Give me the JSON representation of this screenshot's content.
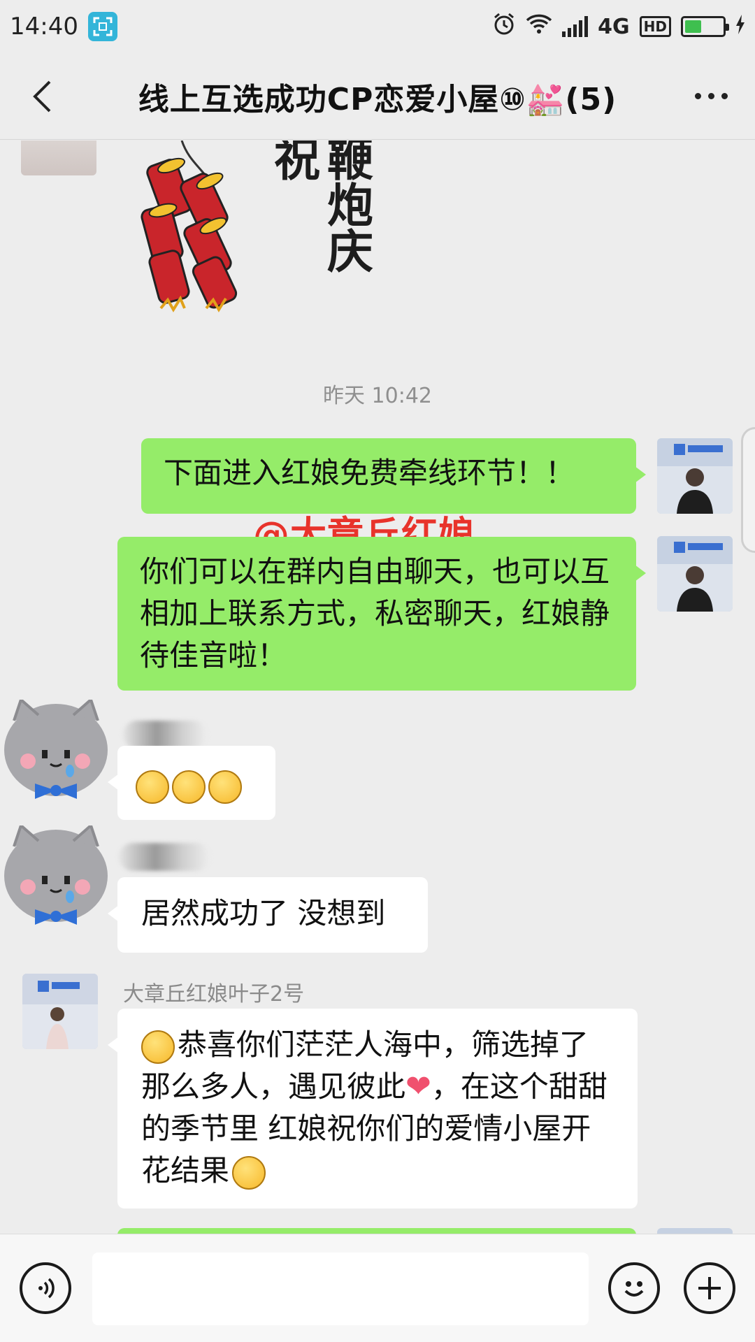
{
  "status_bar": {
    "time": "14:40",
    "network": "4G",
    "hd": "HD",
    "battery_level": 0.45,
    "icons": [
      "screenshot-app-icon",
      "alarm-icon",
      "wifi-icon",
      "signal-icon",
      "battery-icon",
      "charging-icon"
    ]
  },
  "header": {
    "title": "线上互选成功CP恋爱小屋⑩💒(5)",
    "back_icon": "chevron-left-icon",
    "more_icon": "more-dots-icon"
  },
  "chat": {
    "sticker": {
      "text": "鞭炮庆祝",
      "image": "firecracker-sticker"
    },
    "timestamp": "昨天 10:42",
    "watermark": "@大章丘红娘",
    "messages": [
      {
        "side": "right",
        "color": "green",
        "text": "下面进入红娘免费牵线环节！！"
      },
      {
        "side": "right",
        "color": "green",
        "text": "你们可以在群内自由聊天，也可以互相加上联系方式，私密聊天，红娘静待佳音啦！"
      },
      {
        "side": "left",
        "color": "white",
        "emoji": [
          "smirk-emoji",
          "smirk-emoji",
          "smirk-emoji"
        ]
      },
      {
        "side": "left",
        "color": "white",
        "text": "居然成功了 没想到"
      },
      {
        "side": "left",
        "color": "white",
        "sender": "大章丘红娘叶子2号",
        "text_parts": [
          "恭喜你们茫茫人海中，筛选掉了那么多人，遇见彼此",
          "，在这个甜甜的季节里 红娘祝你们的爱情小屋开花结果"
        ],
        "emoji": [
          "grin-emoji",
          "heart-emoji",
          "smile-emoji"
        ]
      }
    ],
    "colors": {
      "green_bubble": "#95ec69",
      "white_bubble": "#ffffff",
      "background": "#ededed"
    }
  },
  "input_bar": {
    "placeholder": "",
    "icons": [
      "voice-icon",
      "emoji-icon",
      "plus-icon"
    ]
  }
}
